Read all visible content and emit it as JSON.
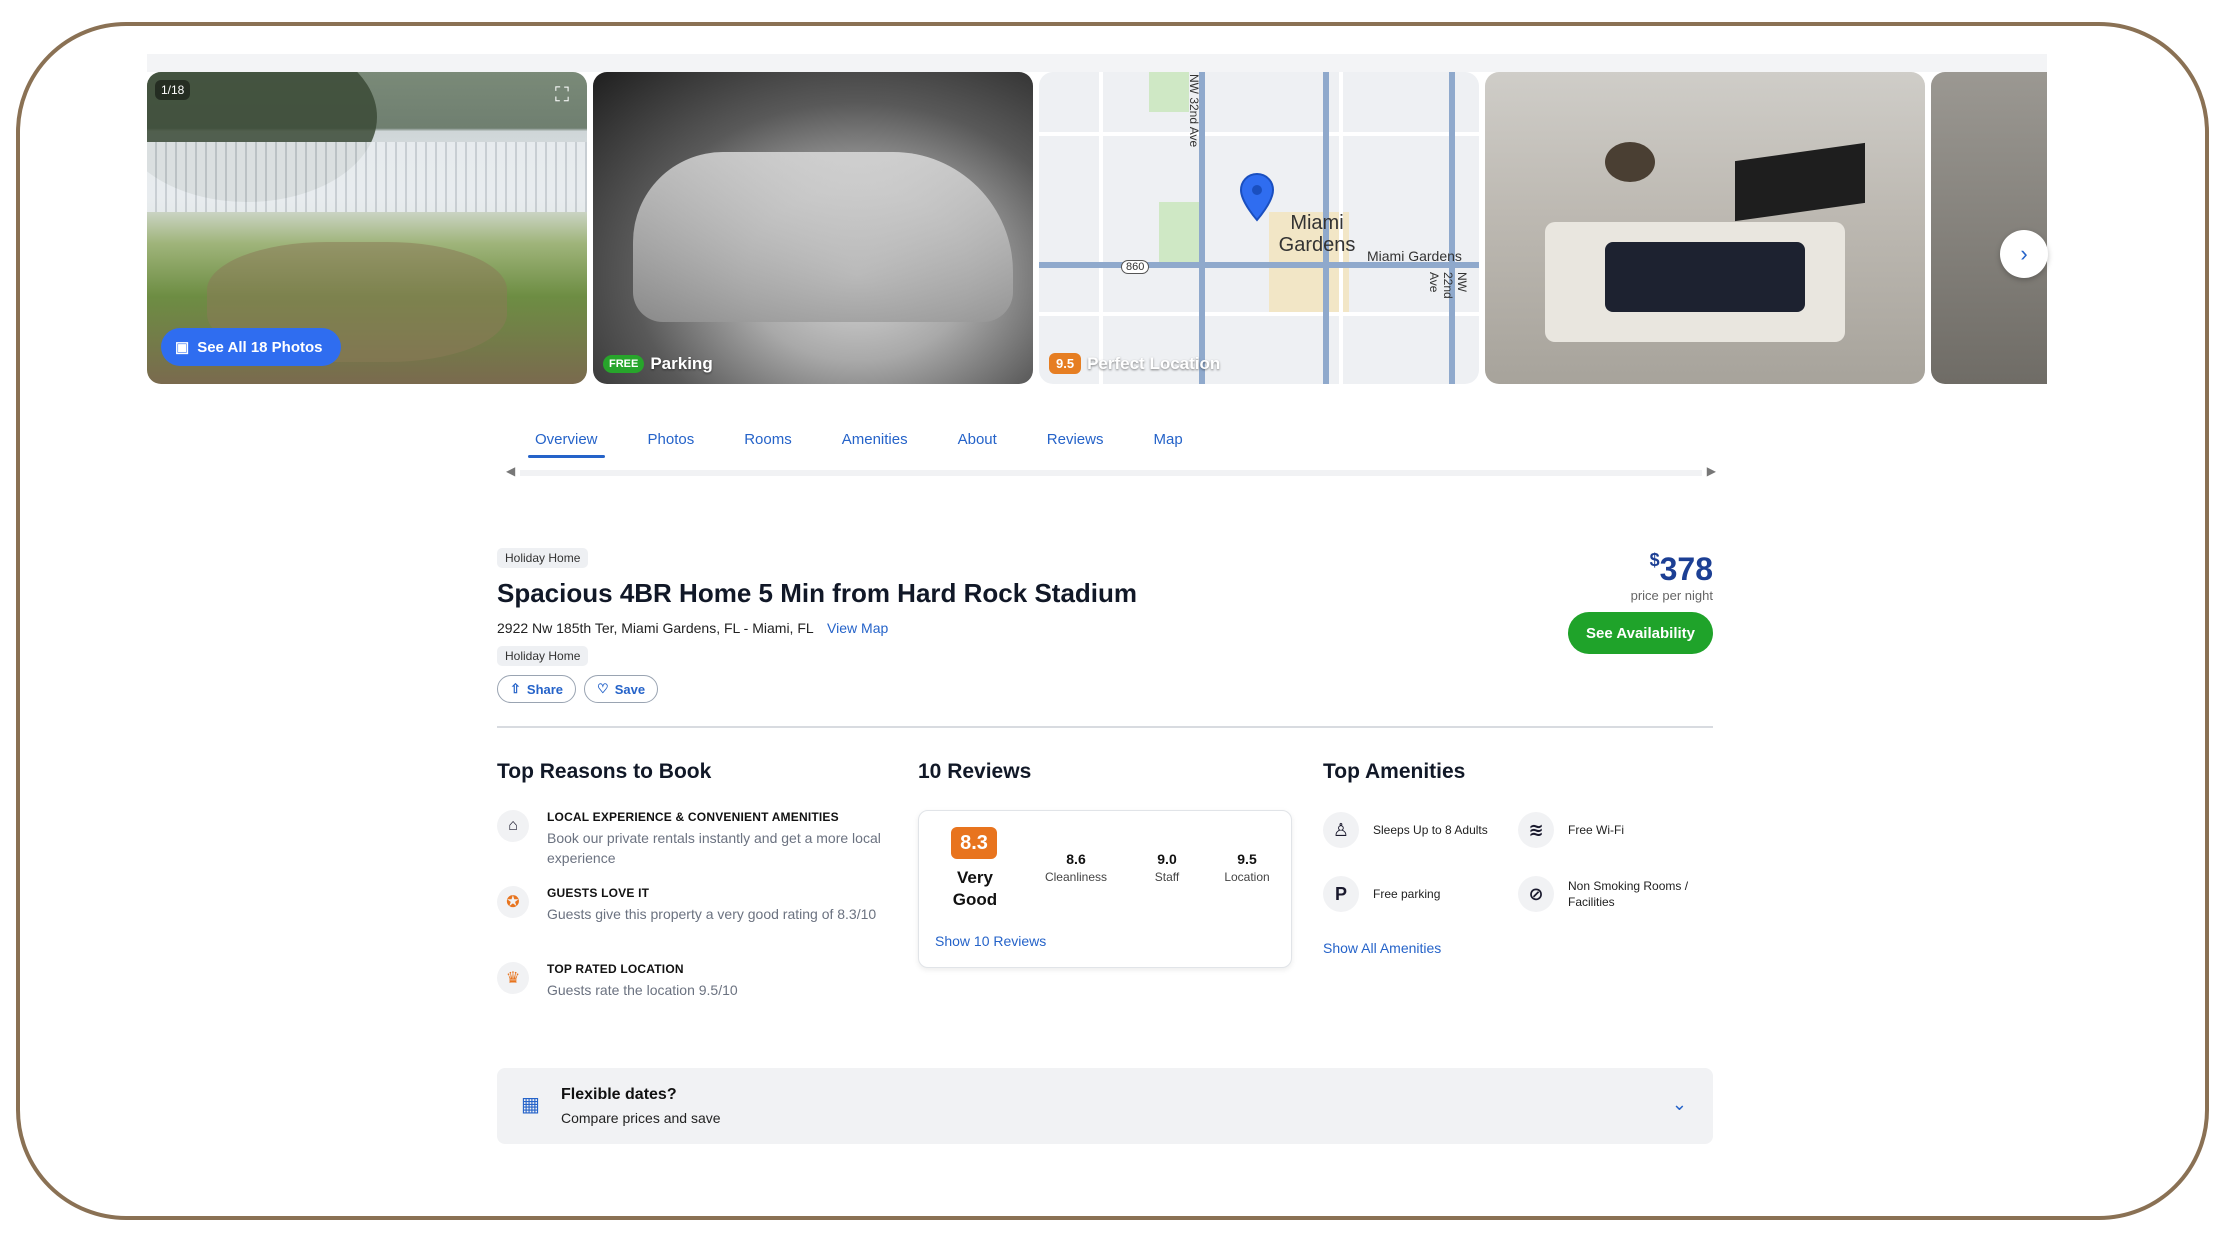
{
  "gallery": {
    "counter": "1/18",
    "see_all_label": "See All 18 Photos",
    "parking_badge": "FREE",
    "parking_label": "Parking",
    "location_score": "9.5",
    "location_label": "Perfect Location",
    "map_labels": {
      "city": "Miami Gardens",
      "road_ne": "Miami Gardens",
      "road_32": "NW 32nd Ave",
      "road_22": "NW 22nd Ave",
      "shield": "860"
    }
  },
  "tabs": [
    "Overview",
    "Photos",
    "Rooms",
    "Amenities",
    "About",
    "Reviews",
    "Map"
  ],
  "property": {
    "type_pill": "Holiday Home",
    "title": "Spacious 4BR Home 5 Min from Hard Rock Stadium",
    "address": "2922 Nw 185th Ter, Miami Gardens, FL - Miami, FL",
    "view_map": "View Map",
    "type_pill_2": "Holiday Home",
    "share_label": "Share",
    "save_label": "Save",
    "price_currency": "$",
    "price_value": "378",
    "price_note": "price per night",
    "availability_label": "See Availability"
  },
  "reasons": {
    "title": "Top Reasons to Book",
    "items": [
      {
        "icon": "house-icon",
        "head": "LOCAL EXPERIENCE & CONVENIENT AMENITIES",
        "body": "Book our private rentals instantly and get a more local experience"
      },
      {
        "icon": "award-icon",
        "head": "GUESTS LOVE IT",
        "body": "Guests give this property a very good rating of 8.3/10"
      },
      {
        "icon": "trophy-icon",
        "head": "TOP RATED LOCATION",
        "body": "Guests rate the location 9.5/10"
      }
    ]
  },
  "reviews": {
    "title": "10 Reviews",
    "score": "8.3",
    "score_word": "Very Good",
    "subs": [
      {
        "value": "8.6",
        "label": "Cleanliness"
      },
      {
        "value": "9.0",
        "label": "Staff"
      },
      {
        "value": "9.5",
        "label": "Location"
      }
    ],
    "show_label": "Show 10 Reviews"
  },
  "amenities": {
    "title": "Top Amenities",
    "items": [
      {
        "icon": "person-icon",
        "label": "Sleeps Up to 8 Adults"
      },
      {
        "icon": "wifi-icon",
        "label": "Free Wi-Fi"
      },
      {
        "icon": "parking-icon",
        "label": "Free parking"
      },
      {
        "icon": "no-smoking-icon",
        "label": "Non Smoking Rooms / Facilities"
      }
    ],
    "show_label": "Show All Amenities"
  },
  "flexible": {
    "title": "Flexible dates?",
    "subtitle": "Compare prices and save"
  },
  "colors": {
    "accent": "#2563c9",
    "price": "#1c3f94",
    "cta_green": "#1fa32a",
    "score_orange": "#e8741e",
    "frame": "#8a7154"
  }
}
